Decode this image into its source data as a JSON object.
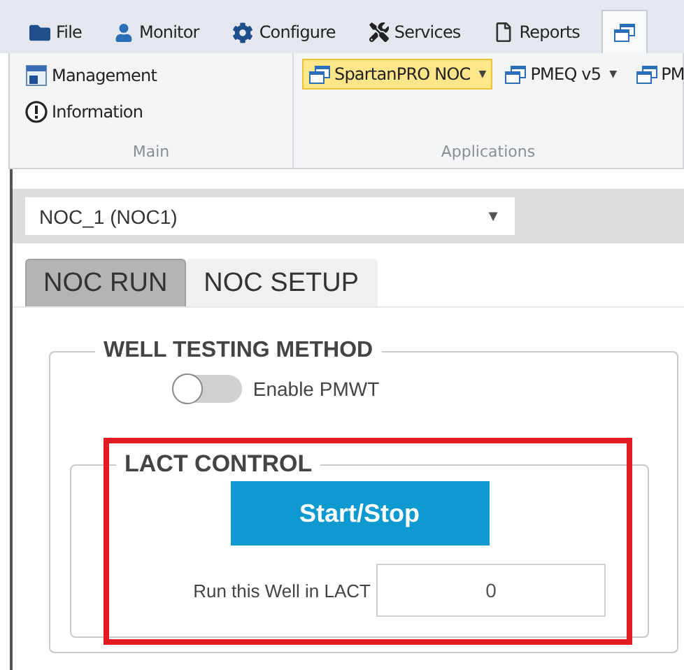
{
  "menu_tabs": [
    {
      "label": "File",
      "selected": false
    },
    {
      "label": "Monitor",
      "selected": false
    },
    {
      "label": "Configure",
      "selected": false
    },
    {
      "label": "Services",
      "selected": false
    },
    {
      "label": "Reports",
      "selected": false
    },
    {
      "selected": true
    }
  ],
  "ribbon": {
    "groups": [
      {
        "label": "Main",
        "items": [
          {
            "label": "Management",
            "dropdown": false,
            "highlighted": false
          },
          {
            "label": "Information",
            "dropdown": false,
            "highlighted": false
          }
        ]
      },
      {
        "label": "Applications",
        "items": [
          {
            "label": "SpartanPRO NOC",
            "dropdown": true,
            "highlighted": true
          },
          {
            "label": "PMEQ v5",
            "dropdown": true,
            "highlighted": false
          },
          {
            "label": "PM",
            "dropdown": false,
            "highlighted": false
          }
        ]
      }
    ]
  },
  "device_select": {
    "value": "NOC_1 (NOC1)",
    "arrow": "▼"
  },
  "tabs": [
    {
      "label": "NOC RUN",
      "selected": true
    },
    {
      "label": "NOC SETUP",
      "selected": false
    }
  ],
  "well_testing": {
    "title": "WELL TESTING METHOD",
    "toggle": {
      "label": "Enable PMWT",
      "on": false
    }
  },
  "lact_control": {
    "title": "LACT CONTROL",
    "button": "Start/Stop",
    "field": {
      "label": "Run this Well in LACT",
      "value": "0"
    },
    "highlighted": true
  }
}
